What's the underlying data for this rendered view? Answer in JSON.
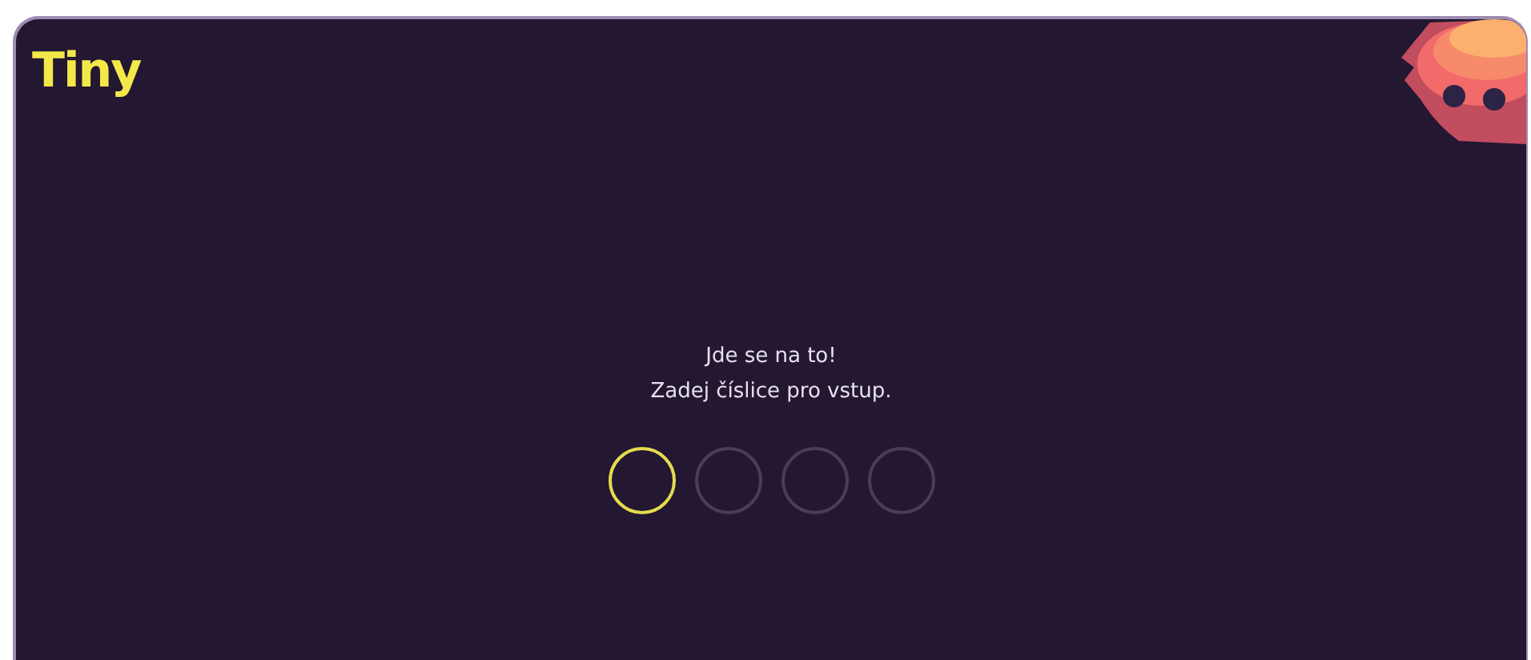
{
  "logo": {
    "text": "Tiny"
  },
  "prompt": {
    "title": "Jde se na to!",
    "subtitle": "Zadej číslice pro vstup."
  },
  "code_digits": [
    {
      "selected": true
    },
    {
      "selected": false
    },
    {
      "selected": false
    },
    {
      "selected": false
    }
  ]
}
